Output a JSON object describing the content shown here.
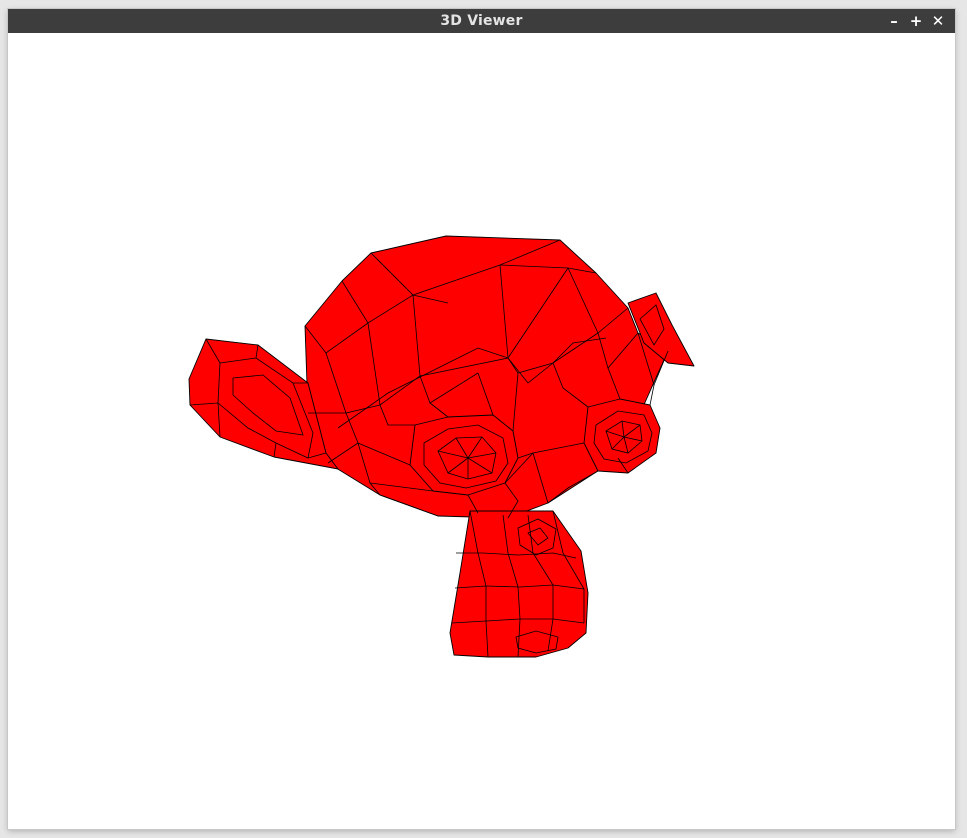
{
  "window": {
    "title": "3D Viewer",
    "controls": {
      "minimize": "–",
      "maximize": "+",
      "close": "✕"
    }
  },
  "viewport": {
    "background": "#ffffff",
    "model_fill": "#ff0000",
    "wire_color": "#000000"
  }
}
